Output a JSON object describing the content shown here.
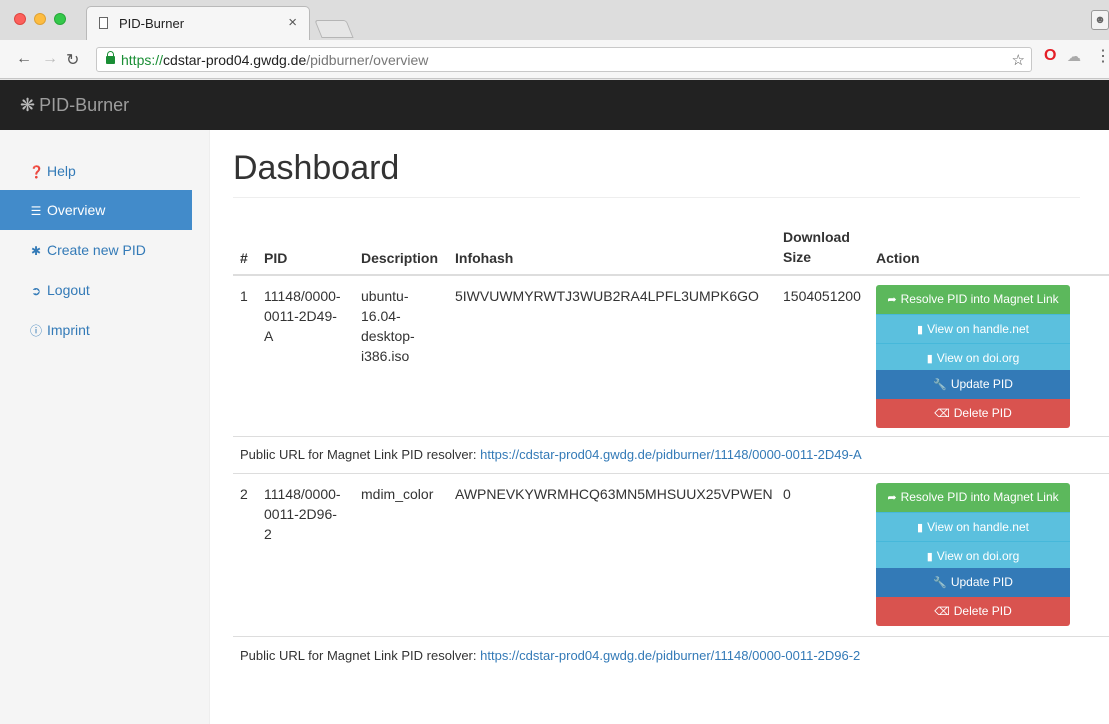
{
  "browser": {
    "tab_title": "PID-Burner",
    "tab_close": "×",
    "url_scheme": "https://",
    "url_host": "cdstar-prod04.gwdg.de",
    "url_path": "/pidburner/overview",
    "icons": [
      "back-icon",
      "forward-icon",
      "reload-icon",
      "lock-icon",
      "star-icon",
      "opera-icon",
      "cloud-icon",
      "menu-icon"
    ]
  },
  "app": {
    "brand": "PID-Burner",
    "brand_color": "#9d9d9d",
    "navbar_color": "#222222"
  },
  "sidebar": {
    "items": [
      {
        "label": "Help",
        "icon": "question-circle-icon",
        "active": false
      },
      {
        "label": "Overview",
        "icon": "list-icon",
        "active": true
      },
      {
        "label": "Create new PID",
        "icon": "asterisk-icon",
        "active": false
      },
      {
        "label": "Logout",
        "icon": "log-out-icon",
        "active": false
      },
      {
        "label": "Imprint",
        "icon": "info-circle-icon",
        "active": false
      }
    ],
    "active_color": "#428bca"
  },
  "main": {
    "title": "Dashboard",
    "columns": {
      "index": "#",
      "pid": "PID",
      "description": "Description",
      "infohash": "Infohash",
      "size_line1": "Download",
      "size_line2": "Size",
      "action": "Action"
    },
    "actions": {
      "resolve": "Resolve PID into Magnet Link",
      "handle": "View on handle.net",
      "doi": "View on doi.org",
      "update": "Update PID",
      "delete": "Delete PID"
    },
    "public_url_label": "Public URL for Magnet Link PID resolver:",
    "rows": [
      {
        "index": "1",
        "pid_lines": [
          "11148/0000-",
          "0011-2D49-",
          "A"
        ],
        "description_lines": [
          "ubuntu-",
          "16.04-",
          "desktop-",
          "i386.iso"
        ],
        "infohash": "5IWVUWMYRWTJ3WUB2RA4LPFL3UMPK6GO",
        "size": "1504051200",
        "public_url": "https://cdstar-prod04.gwdg.de/pidburner/11148/0000-0011-2D49-A"
      },
      {
        "index": "2",
        "pid_lines": [
          "11148/0000-",
          "0011-2D96-",
          "2"
        ],
        "description_lines": [
          "mdim_color"
        ],
        "infohash": "AWPNEVKYWRMHCQ63MN5MHSUUX25VPWEN",
        "size": "0",
        "public_url": "https://cdstar-prod04.gwdg.de/pidburner/11148/0000-0011-2D96-2"
      }
    ],
    "colors": {
      "success": "#5cb85c",
      "info": "#5bc0de",
      "primary": "#337ab7",
      "danger": "#d9534f",
      "link": "#337ab7"
    }
  }
}
